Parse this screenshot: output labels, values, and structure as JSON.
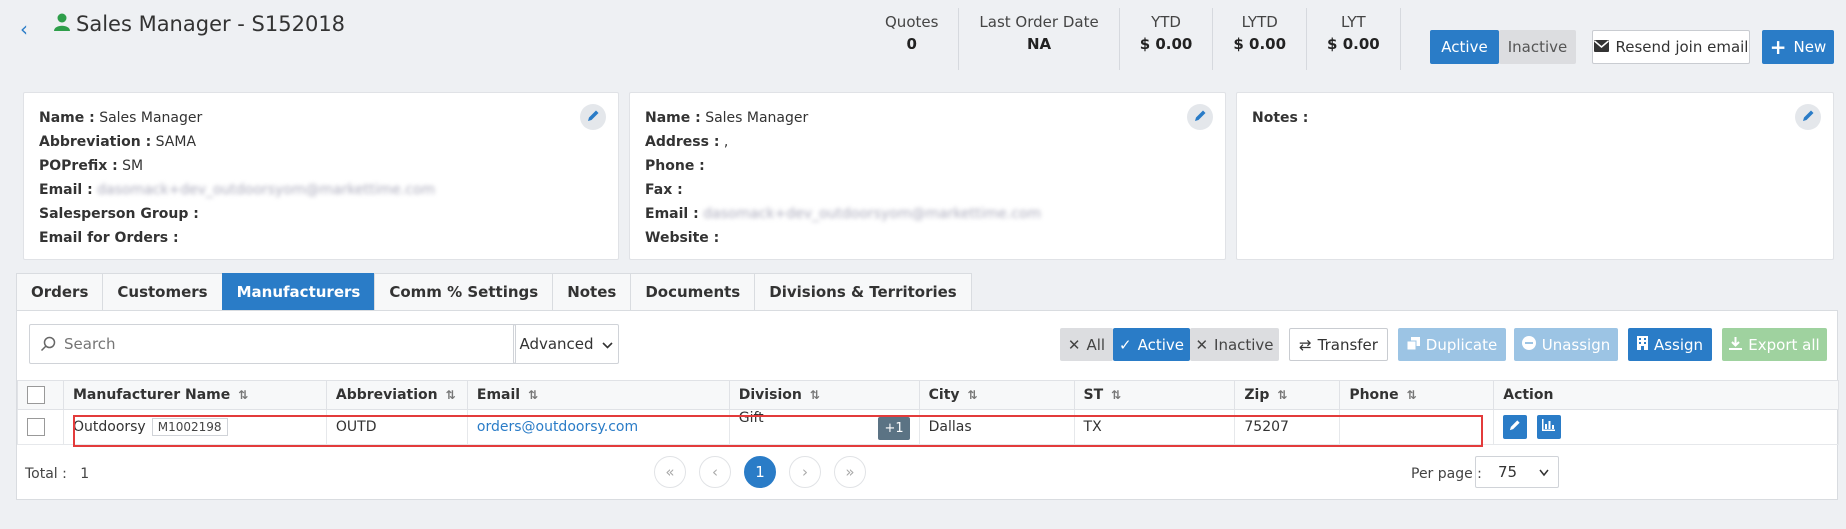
{
  "header": {
    "back_glyph": "‹",
    "title": "Sales Manager - S152018",
    "stats": [
      {
        "label": "Quotes",
        "value": "0"
      },
      {
        "label": "Last Order Date",
        "value": "NA"
      },
      {
        "label": "YTD",
        "value": "$ 0.00"
      },
      {
        "label": "LYTD",
        "value": "$ 0.00"
      },
      {
        "label": "LYT",
        "value": "$ 0.00"
      }
    ],
    "active_label": "Active",
    "inactive_label": "Inactive",
    "resend_label": "Resend join email",
    "new_label": "New"
  },
  "card1": {
    "name_label": "Name :",
    "name_value": "Sales Manager",
    "abbr_label": "Abbreviation :",
    "abbr_value": "SAMA",
    "poprefix_label": "POPrefix :",
    "poprefix_value": "SM",
    "email_label": "Email :",
    "email_value": "dasomack+dev_outdoorsyom@markettime.com",
    "group_label": "Salesperson Group :",
    "email_orders_label": "Email for Orders :"
  },
  "card2": {
    "name_label": "Name :",
    "name_value": "Sales Manager",
    "address_label": "Address :",
    "address_value": ",",
    "phone_label": "Phone :",
    "fax_label": "Fax :",
    "email_label": "Email :",
    "email_value": "dasomack+dev_outdoorsyom@markettime.com",
    "website_label": "Website :"
  },
  "card3": {
    "notes_label": "Notes :"
  },
  "tabs": [
    "Orders",
    "Customers",
    "Manufacturers",
    "Comm % Settings",
    "Notes",
    "Documents",
    "Divisions & Territories"
  ],
  "toolbar": {
    "search_placeholder": "Search",
    "advanced_label": "Advanced",
    "filter_all": "All",
    "filter_active": "Active",
    "filter_inactive": "Inactive",
    "transfer": "Transfer",
    "duplicate": "Duplicate",
    "unassign": "Unassign",
    "assign": "Assign",
    "export_all": "Export all"
  },
  "table": {
    "headers": [
      "Manufacturer Name",
      "Abbreviation",
      "Email",
      "Division",
      "City",
      "ST",
      "Zip",
      "Phone",
      "Action"
    ],
    "rows": [
      {
        "name": "Outdoorsy",
        "code": "M1002198",
        "abbreviation": "OUTD",
        "email": "orders@outdoorsy.com",
        "division": "Gift",
        "division_extra": "+1",
        "city": "Dallas",
        "st": "TX",
        "zip": "75207",
        "phone": ""
      }
    ]
  },
  "footer": {
    "total_label": "Total :",
    "total_value": "1",
    "first": "«",
    "prev": "‹",
    "current_page": "1",
    "next": "›",
    "last": "»",
    "per_page_label": "Per page :",
    "per_page_value": "75"
  },
  "colors": {
    "primary": "#2a7cc7",
    "success": "#2e9e4a",
    "highlight": "#e33b3b"
  }
}
